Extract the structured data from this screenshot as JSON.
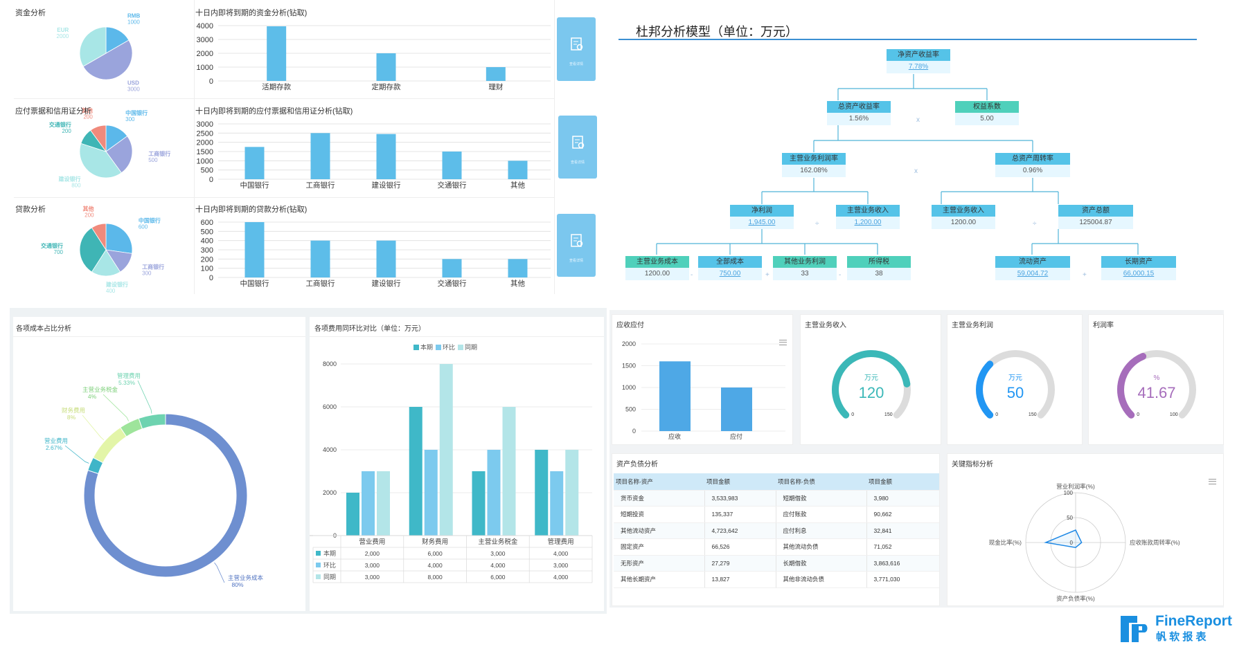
{
  "top_left": {
    "panels": [
      {
        "id": "fund",
        "pie_title": "资金分析",
        "bar_title": "十日内即将到期的资金分析(钻取)",
        "pie": [
          {
            "label": "RMB",
            "value": 1000,
            "color": "#5bb8ea"
          },
          {
            "label": "USD",
            "value": 3000,
            "color": "#9aa4dc"
          },
          {
            "label": "EUR",
            "value": 2000,
            "color": "#a8e6e6"
          }
        ],
        "bars": {
          "categories": [
            "活期存款",
            "定期存款",
            "理财"
          ],
          "values": [
            3950,
            2000,
            1000
          ],
          "ymax": 4000,
          "ticks": [
            "0",
            "1000",
            "2000",
            "3000",
            "4000"
          ]
        }
      },
      {
        "id": "bill",
        "pie_title": "应付票据和信用证分析",
        "bar_title": "十日内即将到期的应付票据和信用证分析(钻取)",
        "pie": [
          {
            "label": "中国银行",
            "value": 300,
            "color": "#5bb8ea"
          },
          {
            "label": "工商银行",
            "value": 500,
            "color": "#9aa4dc"
          },
          {
            "label": "建设银行",
            "value": 800,
            "color": "#a8e6e6"
          },
          {
            "label": "交通银行",
            "value": 200,
            "color": "#3fb5b5"
          },
          {
            "label": "其他",
            "value": 200,
            "color": "#f08a7c"
          }
        ],
        "bars": {
          "categories": [
            "中国银行",
            "工商银行",
            "建设银行",
            "交通银行",
            "其他"
          ],
          "values": [
            1750,
            2500,
            2450,
            1500,
            1000
          ],
          "ymax": 3000,
          "ticks": [
            "0",
            "500",
            "1000",
            "1500",
            "2000",
            "2500",
            "3000"
          ]
        }
      },
      {
        "id": "loan",
        "pie_title": "贷款分析",
        "bar_title": "十日内即将到期的贷款分析(钻取)",
        "pie": [
          {
            "label": "中国银行",
            "value": 600,
            "color": "#5bb8ea"
          },
          {
            "label": "工商银行",
            "value": 300,
            "color": "#9aa4dc"
          },
          {
            "label": "建设银行",
            "value": 400,
            "color": "#a8e6e6"
          },
          {
            "label": "交通银行",
            "value": 700,
            "color": "#3fb5b5"
          },
          {
            "label": "其他",
            "value": 200,
            "color": "#f08a7c"
          }
        ],
        "bars": {
          "categories": [
            "中国银行",
            "工商银行",
            "建设银行",
            "交通银行",
            "其他"
          ],
          "values": [
            600,
            400,
            400,
            200,
            200
          ],
          "ymax": 600,
          "ticks": [
            "0",
            "100",
            "200",
            "300",
            "400",
            "500",
            "600"
          ]
        }
      }
    ],
    "query_button_caption": "查看详情"
  },
  "dupont": {
    "title": "杜邦分析模型（单位：万元）",
    "nodes": [
      {
        "k": "roe",
        "label": "净资产收益率",
        "value": "7.78%",
        "link": true
      },
      {
        "k": "roa",
        "label": "总资产收益率",
        "value": "1.56%",
        "link": false
      },
      {
        "k": "em",
        "label": "权益系数",
        "value": "5.00",
        "link": false
      },
      {
        "k": "npm",
        "label": "主营业务利润率",
        "value": "162.08%",
        "link": false
      },
      {
        "k": "tat",
        "label": "总资产周转率",
        "value": "0.96%",
        "link": false
      },
      {
        "k": "np",
        "label": "净利润",
        "value": "1,945.00",
        "link": true
      },
      {
        "k": "rev1",
        "label": "主营业务收入",
        "value": "1,200.00",
        "link": true
      },
      {
        "k": "rev2",
        "label": "主营业务收入",
        "value": "1200.00",
        "link": false
      },
      {
        "k": "ta",
        "label": "资产总额",
        "value": "125004.87",
        "link": false
      },
      {
        "k": "cost",
        "label": "主营业务成本",
        "value": "1200.00",
        "link": false
      },
      {
        "k": "allcost",
        "label": "全部成本",
        "value": "750.00",
        "link": true
      },
      {
        "k": "oprofit",
        "label": "其他业务利润",
        "value": "33",
        "link": false
      },
      {
        "k": "tax",
        "label": "所得税",
        "value": "38",
        "link": false
      },
      {
        "k": "ca",
        "label": "流动资产",
        "value": "59,004.72",
        "link": true
      },
      {
        "k": "lta",
        "label": "长期资产",
        "value": "66,000.15",
        "link": true
      }
    ],
    "ops": {
      "times": "x",
      "plus": "+",
      "minus": "-",
      "divide": "÷"
    }
  },
  "cost_share": {
    "title": "各项成本占比分析",
    "slices": [
      {
        "label": "主营业务成本",
        "pct": "80%",
        "value": 80,
        "color": "#6e8fd0"
      },
      {
        "label": "营业费用",
        "pct": "2.67%",
        "value": 2.67,
        "color": "#3fb5c8"
      },
      {
        "label": "财务费用",
        "pct": "8%",
        "value": 8,
        "color": "#e3f5a8"
      },
      {
        "label": "主营业务税金",
        "pct": "4%",
        "value": 4,
        "color": "#9ee49b"
      },
      {
        "label": "管理费用",
        "pct": "5.33%",
        "value": 5.33,
        "color": "#6ed3b0"
      }
    ]
  },
  "expense_cmp": {
    "title": "各项费用同环比对比（单位：万元）",
    "chart_data": {
      "type": "bar",
      "categories": [
        "营业费用",
        "财务费用",
        "主营业务税金",
        "管理费用"
      ],
      "series": [
        {
          "name": "本期",
          "values": [
            2000,
            6000,
            3000,
            4000
          ],
          "color": "#3fb8c8"
        },
        {
          "name": "环比",
          "values": [
            3000,
            4000,
            4000,
            3000
          ],
          "color": "#7ccaee"
        },
        {
          "name": "同期",
          "values": [
            3000,
            8000,
            6000,
            4000
          ],
          "color": "#b3e5e8"
        }
      ],
      "ylim": [
        0,
        8000
      ],
      "yticks": [
        "0",
        "2000",
        "4000",
        "6000",
        "8000"
      ]
    },
    "table": [
      [
        "2,000",
        "6,000",
        "3,000",
        "4,000"
      ],
      [
        "3,000",
        "4,000",
        "4,000",
        "3,000"
      ],
      [
        "3,000",
        "8,000",
        "6,000",
        "4,000"
      ]
    ]
  },
  "ar_ap": {
    "title": "应收应付",
    "categories": [
      "应收",
      "应付"
    ],
    "values": [
      1600,
      1000
    ],
    "ymax": 2000,
    "ticks": [
      "0",
      "500",
      "1000",
      "1500",
      "2000"
    ],
    "color": "#4ea8e6"
  },
  "gauges": [
    {
      "title": "主营业务收入",
      "unit": "万元",
      "value": "120",
      "num": 120,
      "min": "0",
      "max": "150",
      "maxnum": 150,
      "color": "#3bb8b8",
      "text_color": "#3bb8b8"
    },
    {
      "title": "主营业务利润",
      "unit": "万元",
      "value": "50",
      "num": 50,
      "min": "0",
      "max": "150",
      "maxnum": 150,
      "color": "#2196f3",
      "text_color": "#2196f3"
    },
    {
      "title": "利润率",
      "unit": "%",
      "value": "41.67",
      "num": 41.67,
      "min": "0",
      "max": "100",
      "maxnum": 100,
      "color": "#a66dbb",
      "text_color": "#a66dbb"
    }
  ],
  "balance": {
    "title": "资产负债分析",
    "headers": [
      "项目名称-资产",
      "项目金额",
      "项目名称-负债",
      "项目金额"
    ],
    "rows": [
      [
        "货币资金",
        "3,533,983",
        "短期借款",
        "3,980"
      ],
      [
        "短期投资",
        "135,337",
        "应付账款",
        "90,662"
      ],
      [
        "其他流动资产",
        "4,723,642",
        "应付利息",
        "32,841"
      ],
      [
        "固定资产",
        "66,526",
        "其他流动负债",
        "71,052"
      ],
      [
        "无形资产",
        "27,279",
        "长期借款",
        "3,863,616"
      ],
      [
        "其他长期资产",
        "13,827",
        "其他非流动负债",
        "3,771,030"
      ]
    ]
  },
  "radar": {
    "title": "关键指标分析",
    "axes": [
      "营业利润率(%)",
      "应收账款周转率(%)",
      "资产负债率(%)",
      "现金比率(%)"
    ],
    "values": [
      25,
      12,
      10,
      60
    ],
    "ticks": [
      "0",
      "50",
      "100"
    ],
    "max": 100
  },
  "brand": {
    "name": "FineReport",
    "sub": "帆 软 报 表"
  }
}
